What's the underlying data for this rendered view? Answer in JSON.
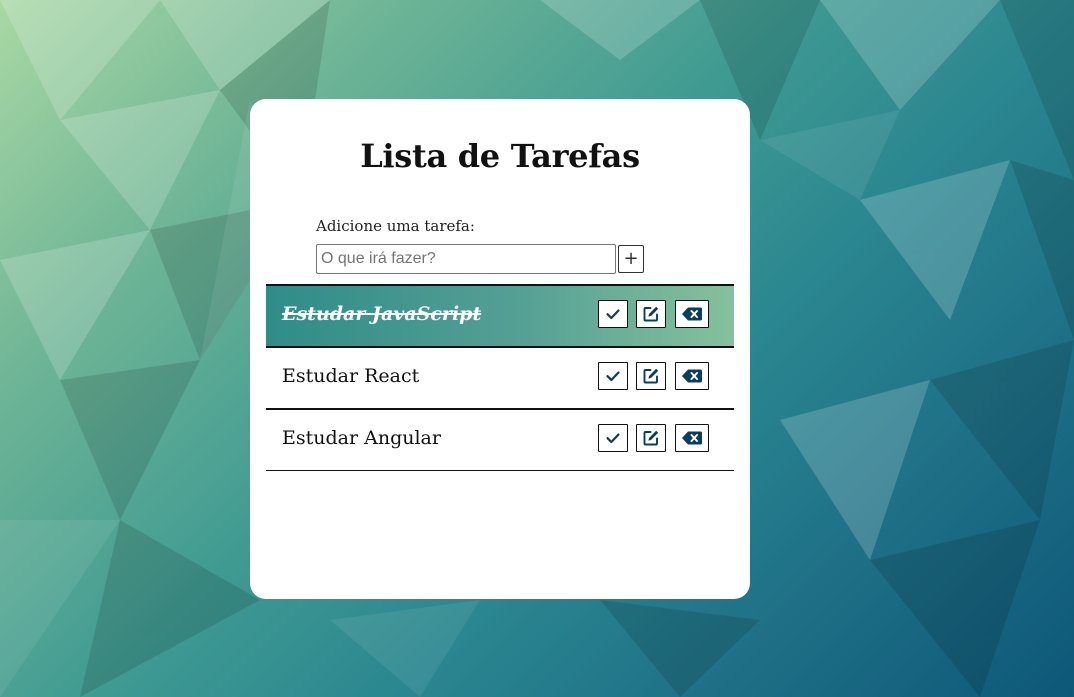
{
  "page": {
    "title": "Lista de Tarefas"
  },
  "form": {
    "label": "Adicione uma tarefa:",
    "input_value": "",
    "placeholder": "O que irá fazer?",
    "add_button_label": "+"
  },
  "tasks": [
    {
      "text": "Estudar JavaScript",
      "done": true
    },
    {
      "text": "Estudar React",
      "done": false
    },
    {
      "text": "Estudar Angular",
      "done": false
    }
  ],
  "icons": {
    "complete": "check-icon",
    "edit": "edit-icon",
    "delete": "backspace-delete-icon"
  },
  "colors": {
    "icon": "#0b3d5c",
    "done_row_start": "#2f8c88",
    "done_row_end": "#86c19d",
    "card": "#ffffff"
  }
}
